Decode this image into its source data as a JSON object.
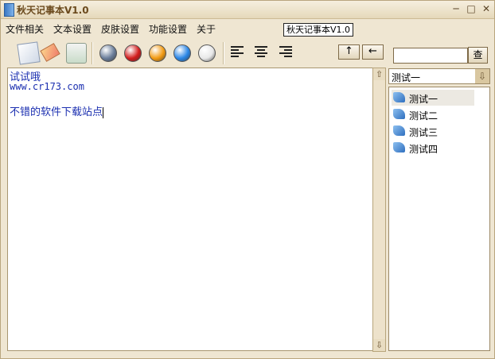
{
  "window": {
    "title": "秋天记事本V1.0",
    "minimize": "─",
    "maximize": "□",
    "close": "✕"
  },
  "menu": [
    "文件相关",
    "文本设置",
    "皮肤设置",
    "功能设置",
    "关于"
  ],
  "app_label": "秋天记事本V1.0",
  "toolbar": {
    "icons": [
      "notepad-icon",
      "eraser-icon",
      "paper-icon"
    ],
    "skin_colors": [
      "#6a7d9a",
      "#d21c1c",
      "#f29a12",
      "#2a86e6",
      "#e8e8e8"
    ],
    "align_icons": [
      "align-left-icon",
      "align-center-icon",
      "align-right-icon"
    ],
    "up_label": "↑",
    "back_label": "←"
  },
  "editor": {
    "lines": [
      "试试哦",
      "www.cr173.com",
      "",
      "不错的软件下载站点"
    ]
  },
  "scroll": {
    "up": "⇧",
    "down": "⇩"
  },
  "search": {
    "value": "",
    "button_label": "查"
  },
  "category": {
    "selected": "测试一",
    "arrow": "⇩"
  },
  "notes": {
    "items": [
      "测试一",
      "测试二",
      "测试三",
      "测试四"
    ],
    "selected_index": 0
  }
}
